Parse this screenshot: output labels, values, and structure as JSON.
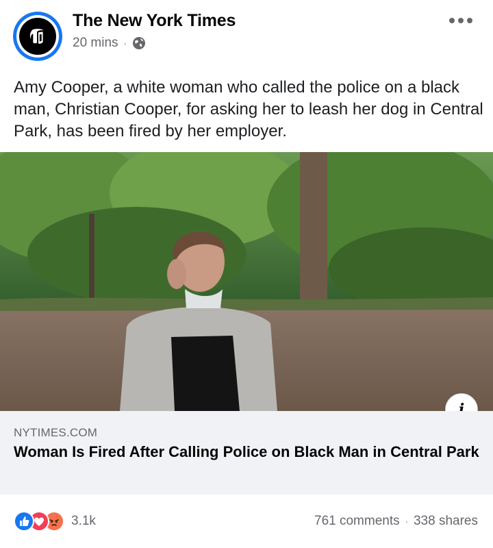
{
  "post": {
    "page_name": "The New York Times",
    "time": "20 mins",
    "separator": "·",
    "audience_icon": "globe-icon",
    "caption": "Amy Cooper, a white woman who called the police on a black man, Christian Cooper, for asking her to leash her dog in Central Park, has been fired by her employer."
  },
  "link": {
    "domain": "NYTIMES.COM",
    "headline": "Woman Is Fired After Calling Police on Black Man in Central Park",
    "info_icon": "i"
  },
  "engagement": {
    "reaction_icons": [
      "like-icon",
      "love-icon",
      "angry-icon"
    ],
    "reaction_count": "3.1k",
    "comments": "761 comments",
    "separator": "·",
    "shares": "338 shares"
  },
  "colors": {
    "facebook_blue": "#1877f2",
    "secondary_text": "#65676b",
    "preview_background": "#f0f2f5"
  }
}
